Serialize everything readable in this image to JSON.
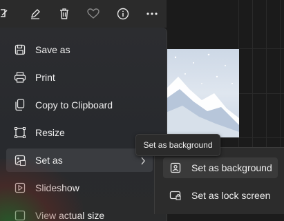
{
  "toolbar": {
    "buttons": [
      {
        "icon": "edit-image-icon"
      },
      {
        "icon": "draw-icon"
      },
      {
        "icon": "delete-icon"
      },
      {
        "icon": "favorite-heart-icon"
      },
      {
        "icon": "info-icon"
      },
      {
        "icon": "more-options-icon"
      }
    ]
  },
  "menu": {
    "items": [
      {
        "label": "Save as",
        "icon": "save-icon"
      },
      {
        "label": "Print",
        "icon": "printer-icon"
      },
      {
        "label": "Copy to Clipboard",
        "icon": "copy-icon"
      },
      {
        "label": "Resize",
        "icon": "resize-icon"
      },
      {
        "label": "Set as",
        "icon": "set-as-image-icon",
        "has_submenu": true
      },
      {
        "label": "Slideshow",
        "icon": "slideshow-icon"
      },
      {
        "label": "View actual size",
        "icon": "view-actual-size-icon"
      }
    ]
  },
  "tooltip": {
    "text": "Set as background"
  },
  "submenu": {
    "items": [
      {
        "label": "Set as background",
        "icon": "desktop-background-icon"
      },
      {
        "label": "Set as lock screen",
        "icon": "lock-screen-icon"
      }
    ]
  },
  "colors": {
    "menu_bg": "#2b2c2f",
    "hover_bg": "#3a3c40",
    "text": "#f0f0f0"
  }
}
